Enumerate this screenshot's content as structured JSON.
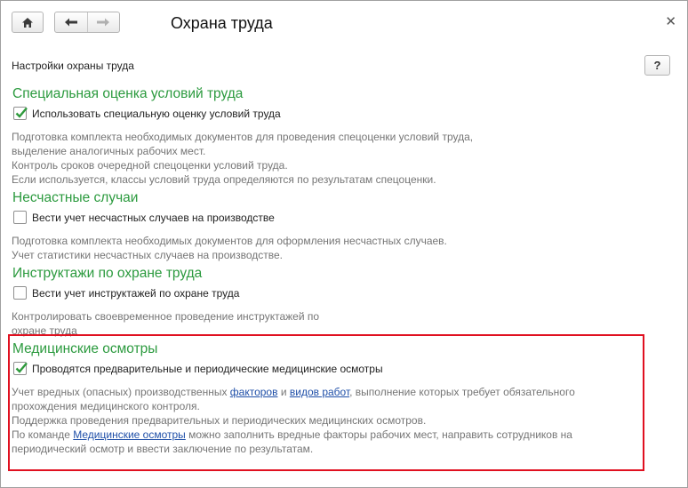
{
  "window": {
    "title": "Охрана труда"
  },
  "settings_caption": "Настройки охраны труда",
  "help_label": "?",
  "sections": [
    {
      "title": "Специальная оценка условий труда",
      "checkbox_label": "Использовать специальную оценку условий труда",
      "checked": true,
      "description": [
        "Подготовка комплекта необходимых документов для проведения спецоценки условий труда,",
        "выделение аналогичных рабочих мест.",
        "Контроль сроков очередной спецоценки условий труда.",
        "Если используется, классы условий труда определяются по результатам спецоценки."
      ]
    },
    {
      "title": "Несчастные случаи",
      "checkbox_label": "Вести учет несчастных случаев на производстве",
      "checked": false,
      "description": [
        "Подготовка комплекта необходимых документов для оформления несчастных случаев.",
        "Учет статистики несчастных случаев на производстве."
      ]
    },
    {
      "title": "Инструктажи по охране труда",
      "checkbox_label": "Вести учет инструктажей по охране труда",
      "checked": false,
      "description": [
        "Контролировать своевременное проведение инструктажей по",
        "охране труда"
      ]
    },
    {
      "title": "Медицинские осмотры",
      "checkbox_label": "Проводятся предварительные и периодические медицинские осмотры",
      "checked": true,
      "description_parts": {
        "line1_pre": "Учет вредных (опасных) производственных ",
        "link_factors": "факторов",
        "line1_mid": " и ",
        "link_work_types": "видов работ",
        "line1_post": ", выполнение которых требует обязательного",
        "line2": "прохождения медицинского контроля.",
        "line3": "Поддержка проведения предварительных и периодических медицинских осмотров.",
        "line4_pre": "По команде ",
        "link_med_exams": "Медицинские осмотры",
        "line4_post": " можно заполнить вредные факторы рабочих мест, направить сотрудников на",
        "line5": "периодический осмотр и ввести заключение по результатам."
      }
    }
  ],
  "colors": {
    "section_title": "#2b9a3e",
    "description": "#757575",
    "link": "#1f4fa8",
    "highlight_border": "#e01020",
    "check_mark": "#2e9a3c"
  },
  "icons": {
    "home": "home-icon",
    "back": "arrow-left-icon",
    "forward": "arrow-right-icon",
    "close": "close-icon"
  }
}
